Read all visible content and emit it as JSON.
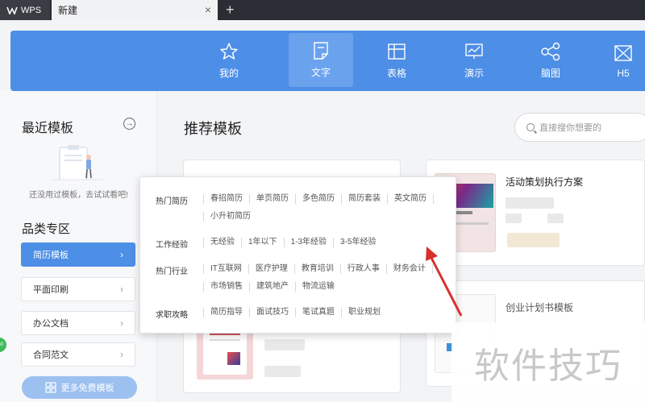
{
  "titlebar": {
    "app_tab": "WPS",
    "doc_tab": "新建",
    "close_glyph": "×",
    "new_tab_glyph": "+"
  },
  "categories": [
    {
      "label": "我的",
      "icon": "star-icon"
    },
    {
      "label": "文字",
      "icon": "document-icon",
      "active": true
    },
    {
      "label": "表格",
      "icon": "table-icon"
    },
    {
      "label": "演示",
      "icon": "presentation-icon"
    },
    {
      "label": "脑图",
      "icon": "mindmap-icon"
    },
    {
      "label": "H5",
      "icon": "h5-icon"
    }
  ],
  "sidebar": {
    "recent_title": "最近模板",
    "recent_arrow": "→",
    "empty_text": "还没用过模板，去试试看吧!",
    "category_title": "品类专区",
    "items": [
      {
        "label": "简历模板",
        "active": true
      },
      {
        "label": "平面印刷"
      },
      {
        "label": "办公文档"
      },
      {
        "label": "合同范文"
      }
    ],
    "chevron": "›",
    "more_button": "更多免费模板"
  },
  "main": {
    "title": "推荐模板",
    "search_placeholder": "直接搜你想要的",
    "card_right_top_title": "活动策划执行方案",
    "card_right_bottom_title": "创业计划书模板"
  },
  "popup": {
    "rows": [
      {
        "label": "热门简历",
        "tags": [
          "春招简历",
          "单页简历",
          "多色简历",
          "简历套装",
          "英文简历",
          "小升初简历"
        ]
      },
      {
        "label": "工作经验",
        "tags": [
          "无经验",
          "1年以下",
          "1-3年经验",
          "3-5年经验"
        ]
      },
      {
        "label": "热门行业",
        "tags": [
          "IT互联网",
          "医疗护理",
          "教育培训",
          "行政人事",
          "财务会计",
          "市场销售",
          "建筑地产",
          "物流运输"
        ]
      },
      {
        "label": "求职攻略",
        "tags": [
          "简历指导",
          "面试技巧",
          "笔试真题",
          "职业规划"
        ]
      }
    ]
  },
  "watermark": "软件技巧",
  "colors": {
    "titlebar": "#2a2d33",
    "accent_blue": "#4d8ee6",
    "arrow_red": "#d9302c",
    "green_badge": "#3dba5b"
  }
}
